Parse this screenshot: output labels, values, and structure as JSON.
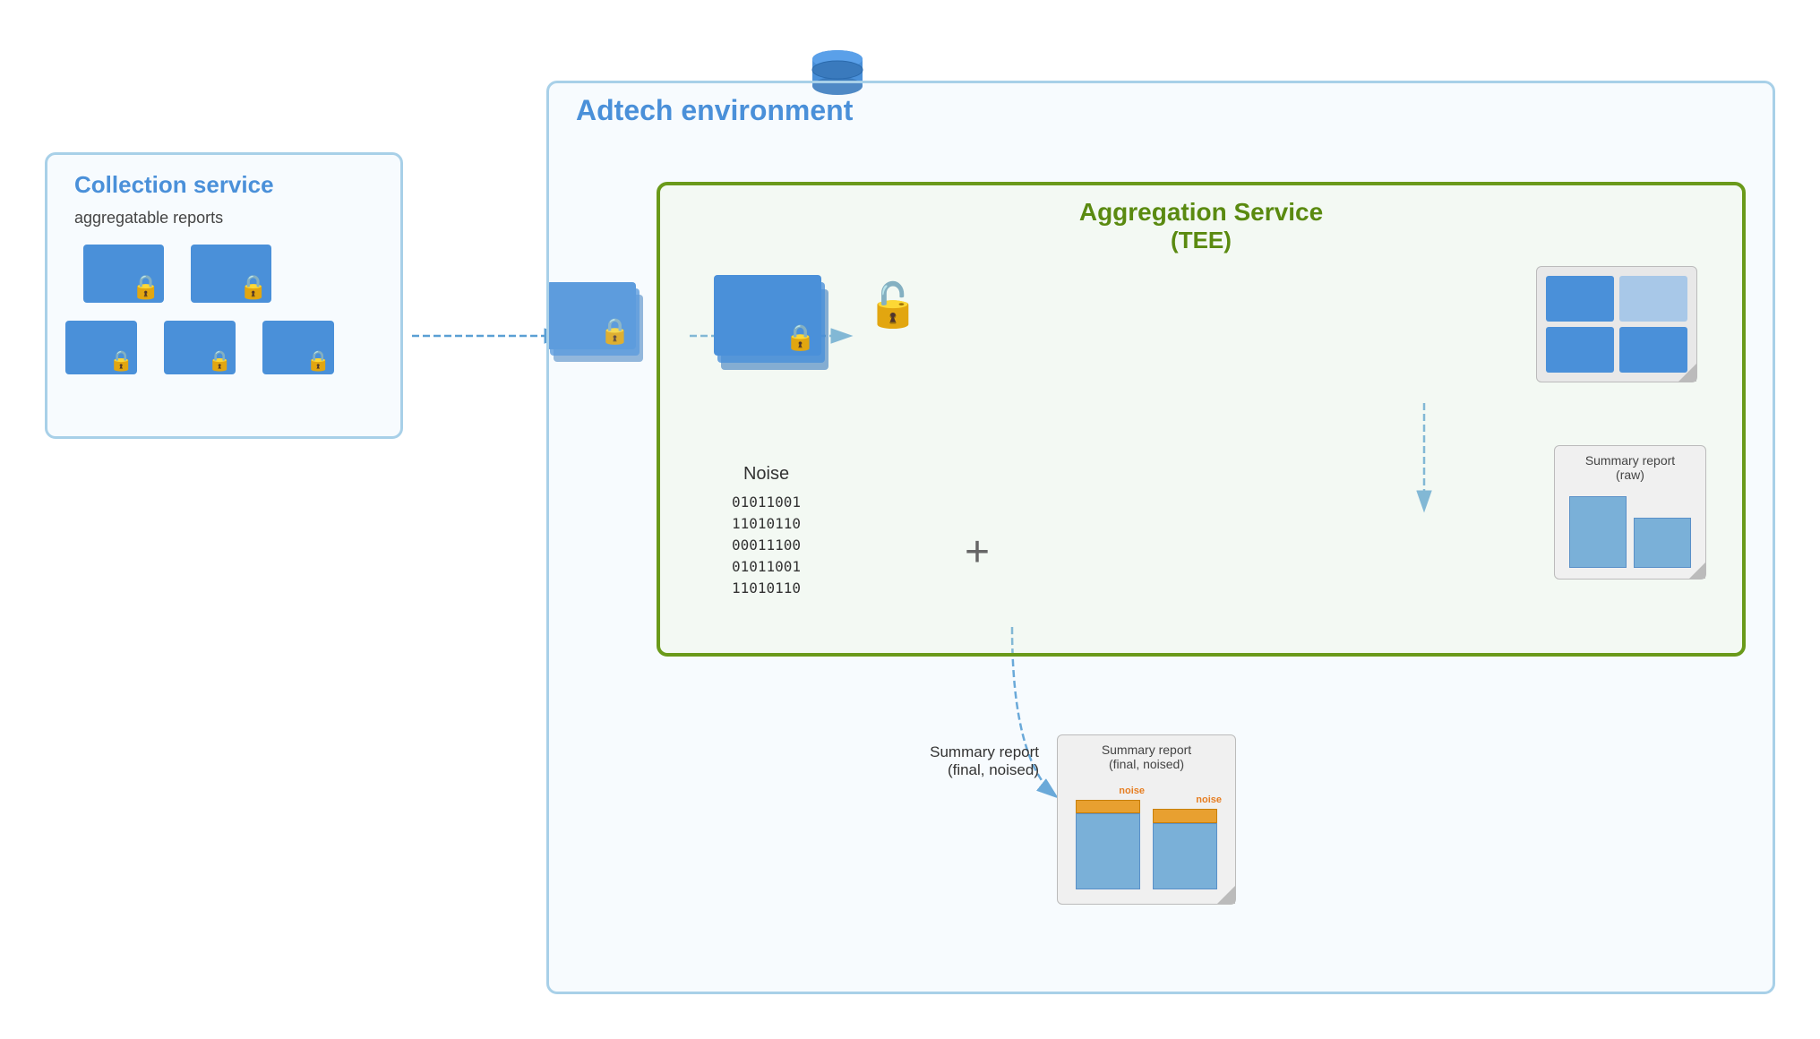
{
  "adtech": {
    "label": "Adtech environment"
  },
  "aggregation": {
    "title_line1": "Aggregation Service",
    "title_line2": "(TEE)"
  },
  "collection": {
    "title": "Collection service",
    "sublabel": "aggregatable reports"
  },
  "noise": {
    "label": "Noise",
    "binary": [
      "01011001",
      "11010110",
      "00011100",
      "01011001",
      "11010110"
    ]
  },
  "summary_raw": {
    "label": "Summary report",
    "sublabel": "(raw)"
  },
  "summary_final": {
    "label": "Summary report",
    "sublabel": "(final, noised)"
  },
  "noise_labels": {
    "bar1": "noise",
    "bar2": "noise"
  }
}
